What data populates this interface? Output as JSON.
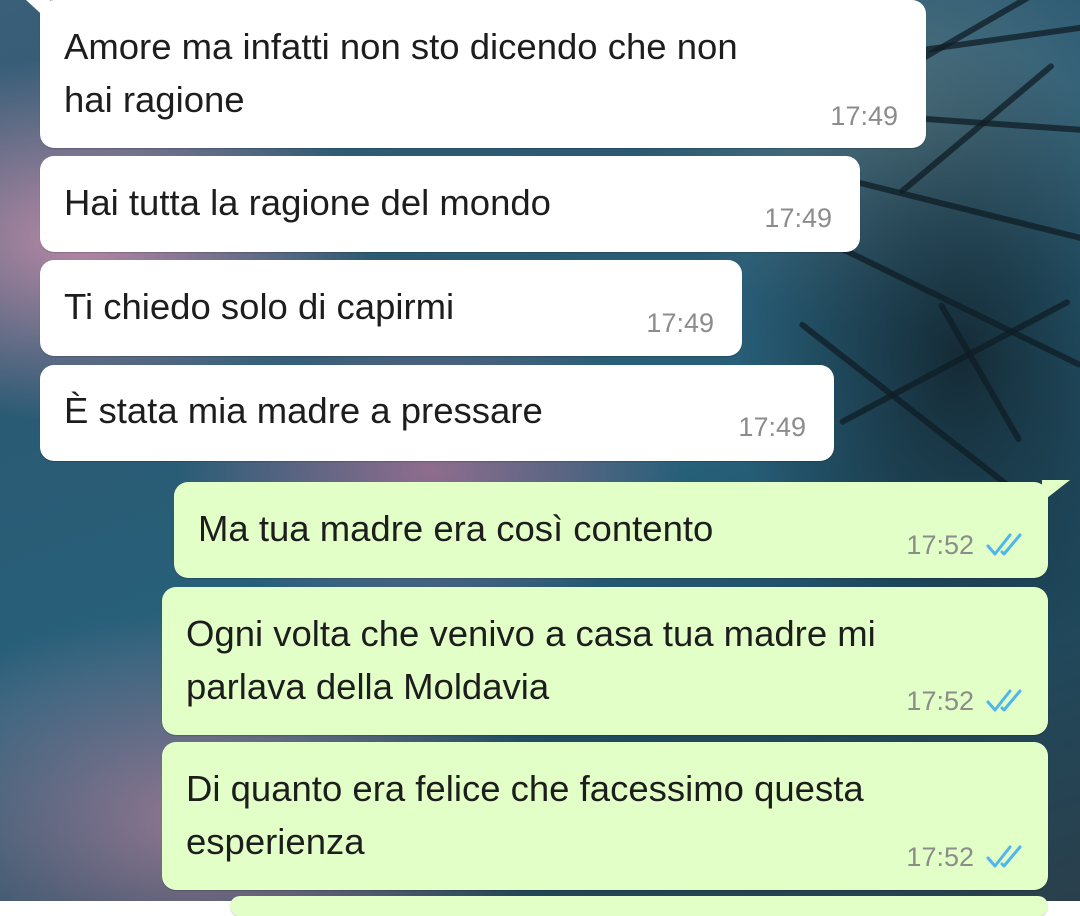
{
  "chat": {
    "messages": [
      {
        "direction": "in",
        "lines": [
          "Amore ma infatti non sto dicendo che non",
          "hai ragione"
        ],
        "time": "17:49"
      },
      {
        "direction": "in",
        "lines": [
          "Hai tutta la ragione del mondo"
        ],
        "time": "17:49"
      },
      {
        "direction": "in",
        "lines": [
          "Ti chiedo solo di capirmi"
        ],
        "time": "17:49"
      },
      {
        "direction": "in",
        "lines": [
          "È stata mia madre a pressare"
        ],
        "time": "17:49"
      },
      {
        "direction": "out",
        "lines": [
          "Ma tua madre era così contento"
        ],
        "time": "17:52",
        "status": "read-double-check-icon"
      },
      {
        "direction": "out",
        "lines": [
          "Ogni volta che venivo a casa tua madre mi",
          "parlava della Moldavia"
        ],
        "time": "17:52",
        "status": "read-double-check-icon"
      },
      {
        "direction": "out",
        "lines": [
          "Di quanto era felice che facessimo questa",
          "esperienza"
        ],
        "time": "17:52",
        "status": "read-double-check-icon"
      }
    ]
  },
  "colors": {
    "incoming_bubble": "#ffffff",
    "outgoing_bubble": "#e2ffc7",
    "timestamp": "#8c8c8c",
    "read_ticks": "#4fb6ec"
  }
}
